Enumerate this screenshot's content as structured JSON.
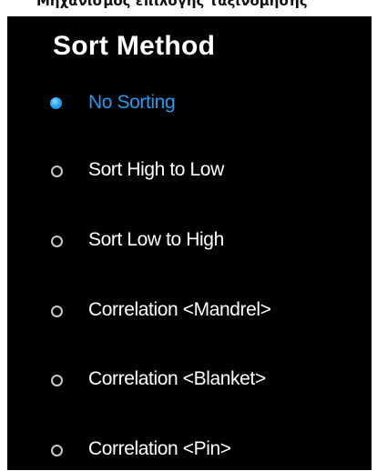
{
  "top_strip_text": "Μηχανισμός επιλογής ταξινόμησης",
  "panel": {
    "title": "Sort Method",
    "options": [
      {
        "label": "No Sorting",
        "selected": true
      },
      {
        "label": "Sort High to Low",
        "selected": false
      },
      {
        "label": "Sort Low to High",
        "selected": false
      },
      {
        "label": "Correlation <Mandrel>",
        "selected": false
      },
      {
        "label": "Correlation <Blanket>",
        "selected": false
      },
      {
        "label": "Correlation <Pin>",
        "selected": false
      }
    ]
  },
  "colors": {
    "background": "#000000",
    "text": "#ffffff",
    "accent": "#1e9cf0",
    "radio_border": "#c9c9c9"
  }
}
